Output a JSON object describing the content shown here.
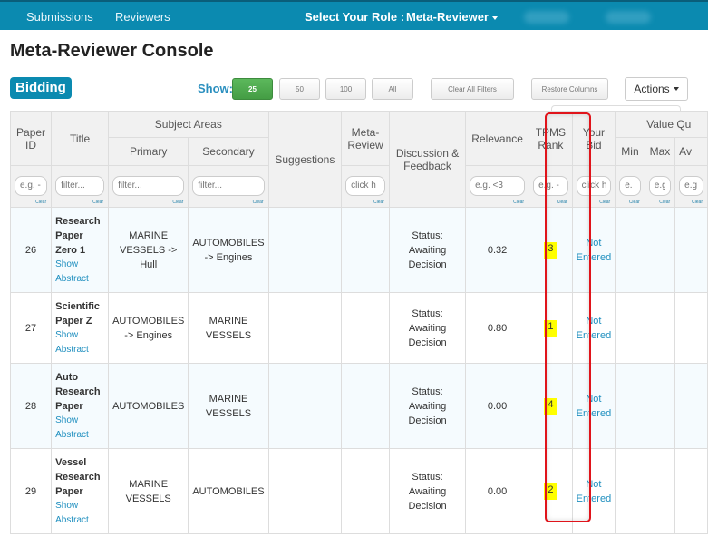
{
  "nav": {
    "links": [
      "Submissions",
      "Reviewers"
    ],
    "role_label": "Select Your Role :",
    "role_value": "Meta-Reviewer"
  },
  "page": {
    "title": "Meta-Reviewer Console",
    "section_badge": "Bidding"
  },
  "toolbar": {
    "show_label": "Show:",
    "page_sizes": [
      "25",
      "50",
      "100",
      "All"
    ],
    "active_page_size": "25",
    "clear_filters": "Clear All Filters",
    "restore_columns": "Restore Columns",
    "actions": "Actions"
  },
  "table": {
    "headers": {
      "paper_id": "Paper ID",
      "title": "Title",
      "subject_areas": "Subject Areas",
      "primary": "Primary",
      "secondary": "Secondary",
      "suggestions": "Suggestions",
      "meta_review": "Meta-Review",
      "discussion": "Discussion & Feedback",
      "relevance": "Relevance",
      "tpms_rank": "TPMS Rank",
      "your_bid": "Your Bid",
      "value_quality": "Value Qu",
      "min": "Min",
      "max": "Max",
      "avg": "Av"
    },
    "filters": {
      "paper_id": "e.g. -",
      "title": "filter...",
      "primary": "filter...",
      "secondary": "filter...",
      "meta_review": "click h",
      "relevance": "e.g. <3",
      "tpms_rank": "e.g. -",
      "your_bid": "click h",
      "min": "e.",
      "max": "e.g",
      "avg": "e.g",
      "clear_label": "Clear"
    },
    "show_abstract": [
      "Show",
      "Abstract"
    ],
    "rows": [
      {
        "id": "26",
        "title": "Research Paper Zero 1",
        "primary": "MARINE VESSELS -> Hull",
        "secondary": "AUTOMOBILES -> Engines",
        "suggestions": "",
        "meta_review": "",
        "discussion": "Status: Awaiting Decision",
        "relevance": "0.32",
        "tpms_rank": "3",
        "bid": "Not Entered"
      },
      {
        "id": "27",
        "title": "Scientific Paper Z",
        "primary": "AUTOMOBILES -> Engines",
        "secondary": "MARINE VESSELS",
        "suggestions": "",
        "meta_review": "",
        "discussion": "Status: Awaiting Decision",
        "relevance": "0.80",
        "tpms_rank": "1",
        "bid": "Not Entered"
      },
      {
        "id": "28",
        "title": "Auto Research Paper",
        "primary": "AUTOMOBILES",
        "secondary": "MARINE VESSELS",
        "suggestions": "",
        "meta_review": "",
        "discussion": "Status: Awaiting Decision",
        "relevance": "0.00",
        "tpms_rank": "4",
        "bid": "Not Entered"
      },
      {
        "id": "29",
        "title": "Vessel Research Paper",
        "primary": "MARINE VESSELS",
        "secondary": "AUTOMOBILES",
        "suggestions": "",
        "meta_review": "",
        "discussion": "Status: Awaiting Decision",
        "relevance": "0.00",
        "tpms_rank": "2",
        "bid": "Not Entered"
      }
    ]
  },
  "colors": {
    "navbar": "#0b8ab0",
    "active_button": "#5cb85c",
    "highlight_border": "#e0141b",
    "rank_highlight": "#ffff00",
    "link": "#1f8fbf"
  }
}
